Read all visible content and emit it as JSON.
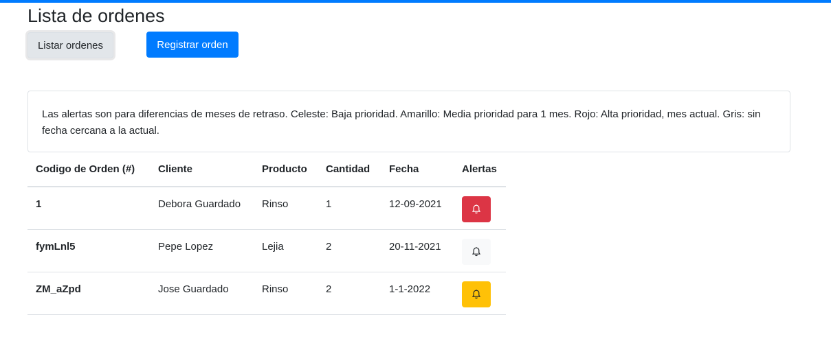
{
  "page": {
    "title": "Lista de ordenes"
  },
  "buttons": {
    "list_label": "Listar ordenes",
    "register_label": "Registrar orden"
  },
  "alert_info": "Las alertas son para diferencias de meses de retraso. Celeste: Baja prioridad. Amarillo: Media prioridad para 1 mes. Rojo: Alta prioridad, mes actual. Gris: sin fecha cercana a la actual.",
  "table": {
    "headers": [
      "Codigo de Orden (#)",
      "Cliente",
      "Producto",
      "Cantidad",
      "Fecha",
      "Alertas"
    ],
    "rows": [
      {
        "code": "1",
        "client": "Debora Guardado",
        "product": "Rinso",
        "quantity": "1",
        "date": "12-09-2021",
        "alert": "red",
        "alert_color": "#dc3545",
        "icon": "bell-icon"
      },
      {
        "code": "fymLnl5",
        "client": "Pepe Lopez",
        "product": "Lejia",
        "quantity": "2",
        "date": "20-11-2021",
        "alert": "gray",
        "alert_color": "#f8f9fa",
        "icon": "bell-icon"
      },
      {
        "code": "ZM_aZpd",
        "client": "Jose Guardado",
        "product": "Rinso",
        "quantity": "2",
        "date": "1-1-2022",
        "alert": "yellow",
        "alert_color": "#ffc107",
        "icon": "bell-icon"
      }
    ]
  },
  "colors": {
    "accent": "#007bff",
    "danger": "#dc3545",
    "warning": "#ffc107",
    "light": "#f8f9fa"
  }
}
